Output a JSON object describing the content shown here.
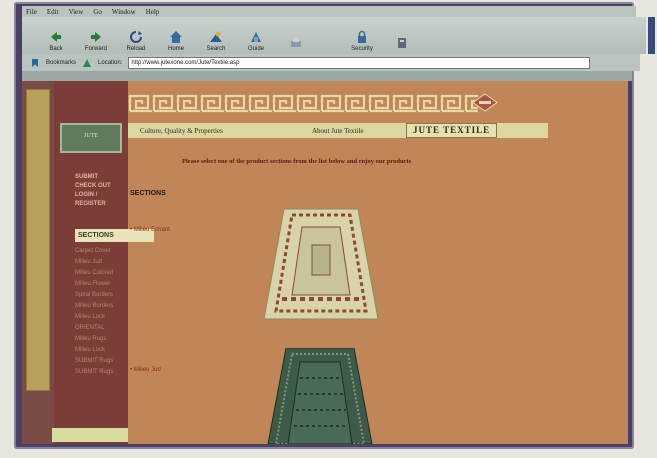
{
  "menu": [
    "File",
    "Edit",
    "View",
    "Go",
    "Window",
    "Help"
  ],
  "toolbar": [
    "Back",
    "Forward",
    "Reload",
    "Home",
    "Search",
    "Guide",
    "",
    "Security",
    ""
  ],
  "location": {
    "bookmarks_label": "Bookmarks",
    "location_label": "Location:",
    "url": "http://www.jutexone.com/Jute/Textile.asp"
  },
  "page": {
    "tabs": [
      "Culture, Quality & Properties",
      "About Jute Textile",
      "JUTE TEXTILE"
    ],
    "intro": "Please select one of the product sections from the list below and enjoy our products",
    "sections_heading": "SECTIONS",
    "items": [
      "• Milieu Echant",
      "• Milieu Jud"
    ]
  },
  "leftnav": {
    "logo": "JUTE",
    "links": [
      "SUBMIT",
      "CHECK OUT",
      "LOGIN / REGISTER"
    ],
    "sections_tab": "SECTIONS",
    "section_items": [
      "Carpet Cover",
      "Milieu Jud",
      "Milieu Colored",
      "Milieu Flower",
      "Spiral Borders",
      "Milieu Borders",
      "Milieu Lock",
      "ORIENTAL",
      "Milieu Rugs",
      "Milieu Lock",
      "SUBMIT Rugs",
      "SUBMIT Rugs"
    ]
  },
  "colors": {
    "page_bg": "#c08657",
    "nav_bg": "#7b3d38",
    "tab_bg": "#dcd7a0",
    "intro_text": "#5a1a16",
    "item_text": "#8a2a1a"
  }
}
